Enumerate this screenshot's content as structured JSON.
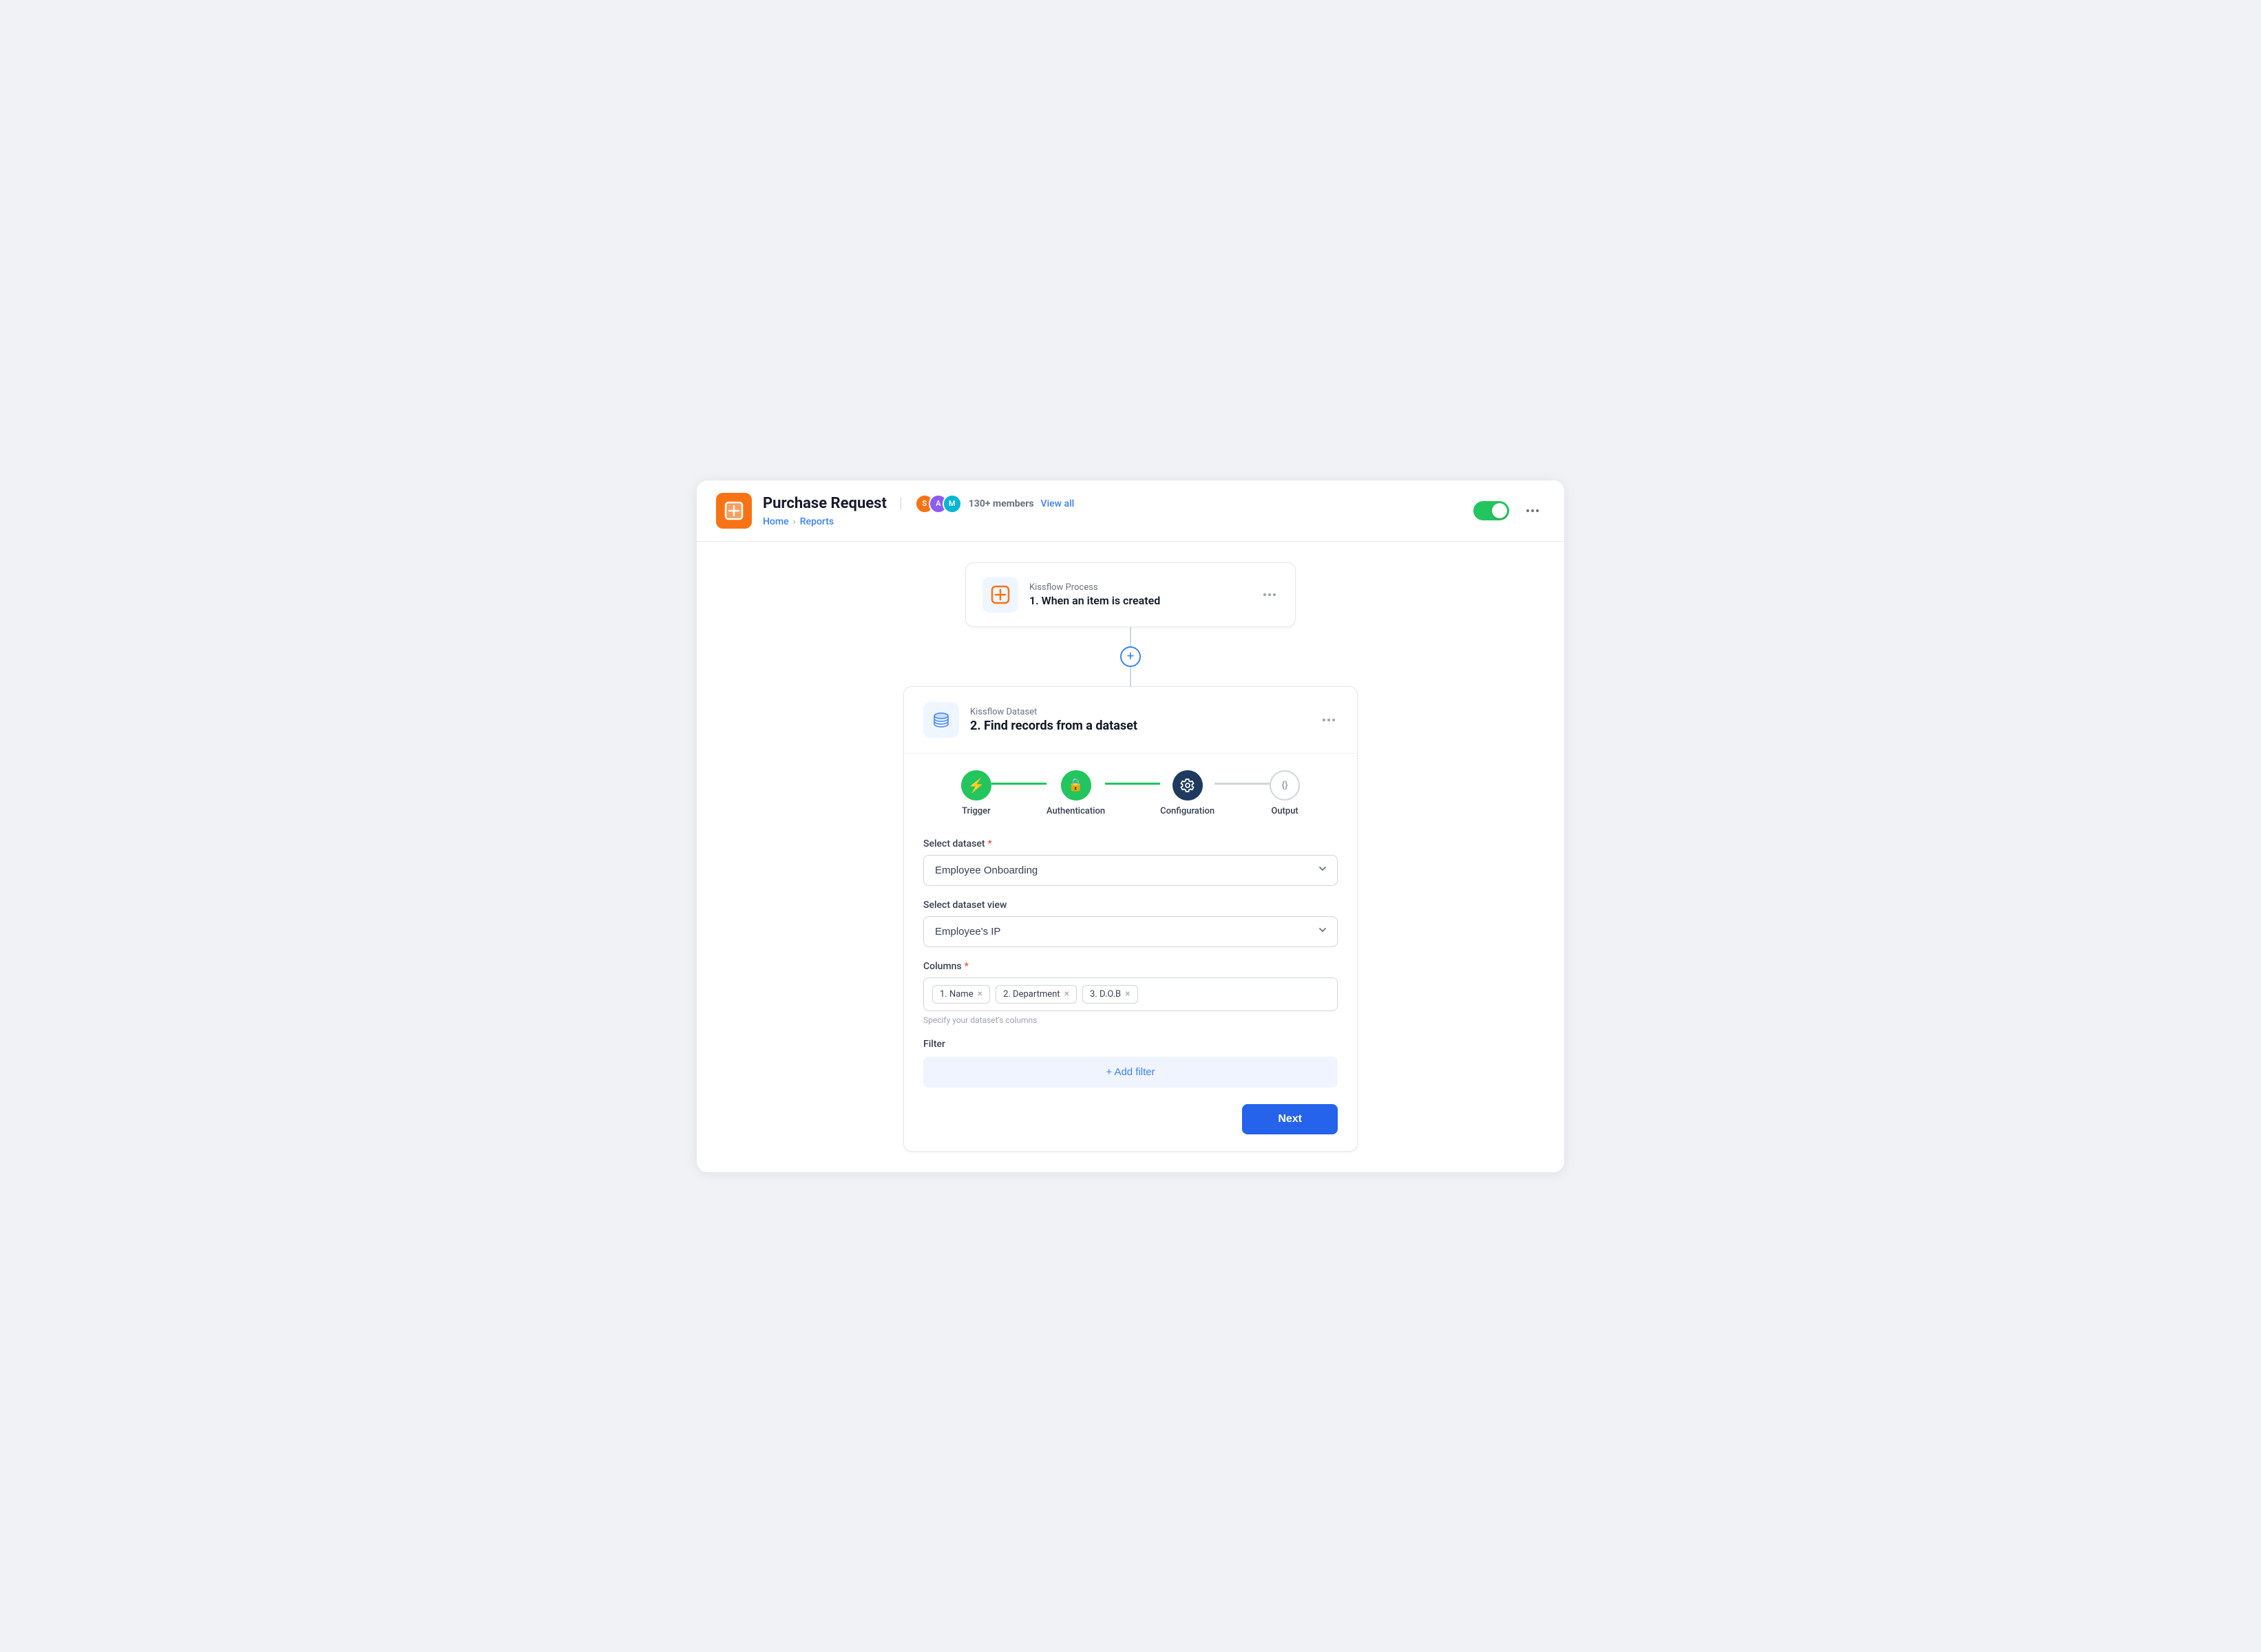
{
  "header": {
    "app_name": "Purchase Request",
    "separator": "|",
    "members_count": "130+ members",
    "view_all": "View all",
    "breadcrumb": {
      "home": "Home",
      "separator": ">",
      "current": "Reports"
    }
  },
  "trigger_card": {
    "source_label": "Kissflow Process",
    "title": "1. When an item is created"
  },
  "dataset_card": {
    "source_label": "Kissflow Dataset",
    "title": "2. Find records from a dataset"
  },
  "steps": [
    {
      "label": "Trigger",
      "state": "active-green",
      "icon": "⚡"
    },
    {
      "label": "Authentication",
      "state": "active-green",
      "icon": "🔒"
    },
    {
      "label": "Configuration",
      "state": "active-dark",
      "icon": "⚙"
    },
    {
      "label": "Output",
      "state": "inactive",
      "icon": "{}"
    }
  ],
  "form": {
    "select_dataset_label": "Select dataset",
    "select_dataset_required": true,
    "select_dataset_value": "Employee Onboarding",
    "select_view_label": "Select dataset view",
    "select_view_value": "Employee's IP",
    "columns_label": "Columns",
    "columns_required": true,
    "columns": [
      {
        "label": "1. Name"
      },
      {
        "label": "2. Department"
      },
      {
        "label": "3. D.O.B"
      }
    ],
    "columns_hint": "Specify your dataset's columns",
    "filter_label": "Filter",
    "add_filter_label": "+ Add filter"
  },
  "actions": {
    "next": "Next"
  },
  "connector": {
    "plus": "+"
  }
}
